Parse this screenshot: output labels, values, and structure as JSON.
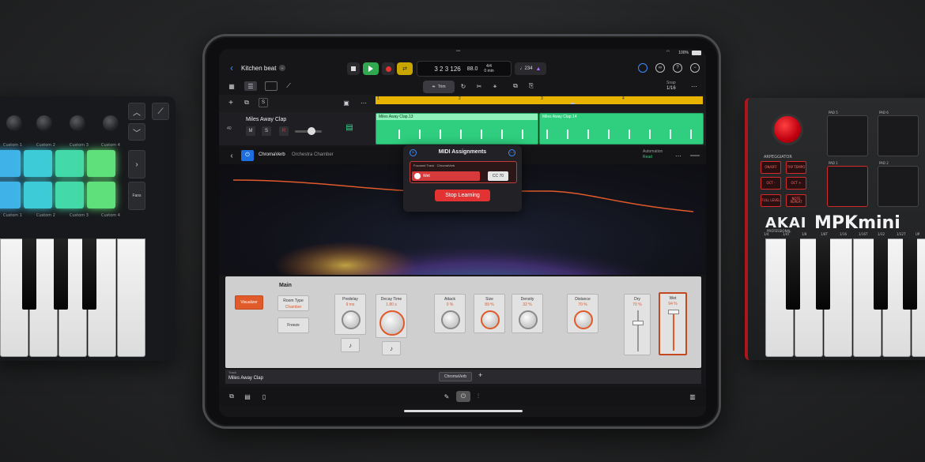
{
  "left_controller": {
    "pad_labels_top": [
      "Custom 1",
      "Custom 2",
      "Custom 3",
      "Custom 4"
    ],
    "pad_labels_bottom": [
      "Custom 1",
      "Custom 2",
      "Custom 3",
      "Custom 4"
    ],
    "side_button_label": "Fans",
    "pad_colors": [
      "#3fb3e8",
      "#3ecbd8",
      "#43d9a8",
      "#5fe07a",
      "#3fb3e8",
      "#3ecbd8",
      "#43d9a8",
      "#5fe07a"
    ]
  },
  "right_controller": {
    "brand": "AKAI",
    "brand_sub": "PROFESSIONAL",
    "model": "MPKmini",
    "arpeggiator_label": "ARPEGGIATOR",
    "buttons": [
      "ON/OFF",
      "TAP TEMPO",
      "OCT -",
      "OCT +",
      "FULL LEVEL",
      "NOTE REPEAT"
    ],
    "pad_labels": [
      "PAD 5",
      "PAD 6",
      "PAD 1",
      "PAD 2"
    ],
    "note_labels": [
      "1/4",
      "1/4T",
      "1/8",
      "1/8T",
      "1/16",
      "1/16T",
      "1/32",
      "1/32T",
      "UP"
    ]
  },
  "ipad": {
    "status": {
      "battery": "100%"
    },
    "header": {
      "back_icon": "chevron-left-icon",
      "project_title": "Kitchen beat",
      "lcd_position": "3 2 3 126",
      "lcd_tempo": "88.0",
      "lcd_signature": "4/4",
      "lcd_time": "0 min",
      "tuner_value": "♩234"
    },
    "toolbar2": {
      "trim_label": "Trim",
      "snap_label": "Snap",
      "snap_value": "1/16"
    },
    "timeline": {
      "bars": [
        "1",
        "2",
        "3",
        "4"
      ]
    },
    "track": {
      "number": "40",
      "name": "Miles Away Clap",
      "mute": "M",
      "solo": "S",
      "record": "R",
      "regions": [
        "Miles Away Clap.13",
        "Miles Away Clap.14"
      ]
    },
    "plugin": {
      "name": "ChromaVerb",
      "preset": "Orchestra Chamber",
      "automation_label": "Automation",
      "automation_value": "Read"
    },
    "midi_popup": {
      "title": "MIDI Assignments",
      "focused_track": "Focused Track · ChromaVerb",
      "parameter": "Wet",
      "cc": "CC 70",
      "stop_button": "Stop Learning"
    },
    "controls": {
      "section": "Main",
      "visualizer_btn": "Visualizer",
      "room_type_label": "Room Type",
      "room_type_value": "Chamber",
      "freeze_btn": "Freeze",
      "predelay_label": "Predelay",
      "predelay_value": "9 ms",
      "decay_label": "Decay Time",
      "decay_value": "1.80 s",
      "attack_label": "Attack",
      "attack_value": "0 %",
      "size_label": "Size",
      "size_value": "89 %",
      "density_label": "Density",
      "density_value": "32 %",
      "distance_label": "Distance",
      "distance_value": "70 %",
      "dry_label": "Dry",
      "dry_value": "70 %",
      "wet_label": "Wet",
      "wet_value": "94 %",
      "dry_level": 0.7,
      "wet_level": 0.94
    },
    "bottom": {
      "track_label": "Track",
      "track_name": "Miles Away Clap",
      "plugin_tab": "ChromaVerb",
      "add": "+"
    },
    "colors": {
      "accent": "#e05a2a",
      "region": "#2fcf7f",
      "ruler": "#e8b400",
      "record": "#e33232"
    }
  }
}
